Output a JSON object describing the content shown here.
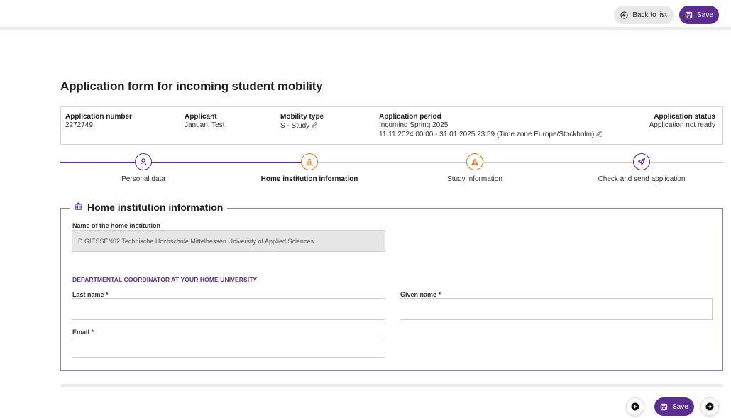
{
  "toolbar": {
    "back_label": "Back to list",
    "save_label": "Save"
  },
  "page": {
    "title": "Application form for incoming student mobility"
  },
  "info": {
    "application_number": {
      "label": "Application number",
      "value": "2272749"
    },
    "applicant": {
      "label": "Applicant",
      "value": "Januari, Test"
    },
    "mobility_type": {
      "label": "Mobility type",
      "value": "S - Study"
    },
    "application_period": {
      "label": "Application period",
      "value": "Incoming Spring 2025",
      "dates": "11.11.2024 00:00 - 31.01.2025 23:59 (Time zone Europe/Stockholm)"
    },
    "application_status": {
      "label": "Application status",
      "value": "Application not ready"
    }
  },
  "steps": [
    {
      "label": "Personal data",
      "icon": "user-icon",
      "state": "done"
    },
    {
      "label": "Home institution information",
      "icon": "institution-icon",
      "state": "current"
    },
    {
      "label": "Study information",
      "icon": "warning-icon",
      "state": "warning"
    },
    {
      "label": "Check and send application",
      "icon": "send-icon",
      "state": "todo"
    }
  ],
  "home_institution": {
    "legend": "Home institution information",
    "name_label": "Name of the home institution",
    "name_value": "D GIESSEN02 Technische Hochschule Mittelhessen University of Applied Sciences",
    "coordinator_heading": "DEPARTMENTAL COORDINATOR AT YOUR HOME UNIVERSITY",
    "last_name_label": "Last name *",
    "last_name_value": "",
    "given_name_label": "Given name *",
    "given_name_value": "",
    "email_label": "Email *",
    "email_value": ""
  },
  "footer": {
    "save_label": "Save"
  },
  "colors": {
    "brand": "#5b2d91",
    "step_orange": "#e8751a",
    "border": "#d6d6d6",
    "disabled_bg": "#e6e6e6"
  }
}
